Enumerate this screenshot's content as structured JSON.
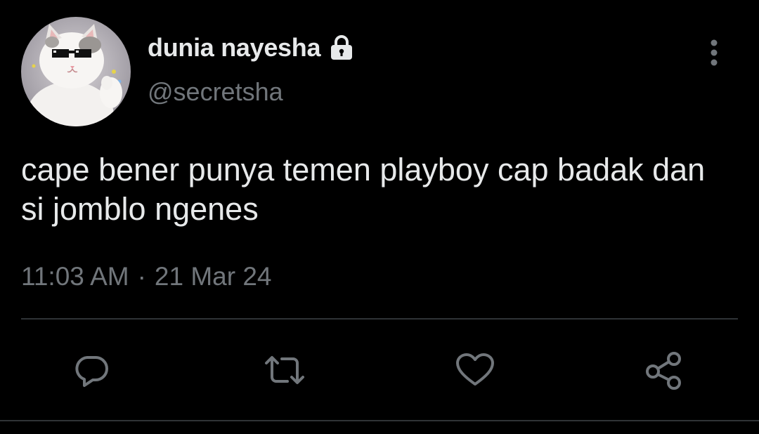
{
  "user": {
    "display_name": "dunia nayesha",
    "handle": "@secretsha",
    "protected_icon": "lock-icon",
    "avatar_icon": "cat-with-sunglasses-avatar"
  },
  "tweet": {
    "text": "cape bener punya temen playboy cap badak dan si jomblo ngenes",
    "time": "11:03 AM",
    "separator": "·",
    "date": "21 Mar 24"
  },
  "actions": [
    {
      "name": "reply",
      "icon": "reply-icon"
    },
    {
      "name": "retweet",
      "icon": "retweet-icon"
    },
    {
      "name": "like",
      "icon": "heart-icon"
    },
    {
      "name": "share",
      "icon": "share-icon"
    }
  ],
  "colors": {
    "background": "#000000",
    "primary_text": "#e7e9ea",
    "secondary_text": "#71767b",
    "divider": "#2f3336"
  }
}
